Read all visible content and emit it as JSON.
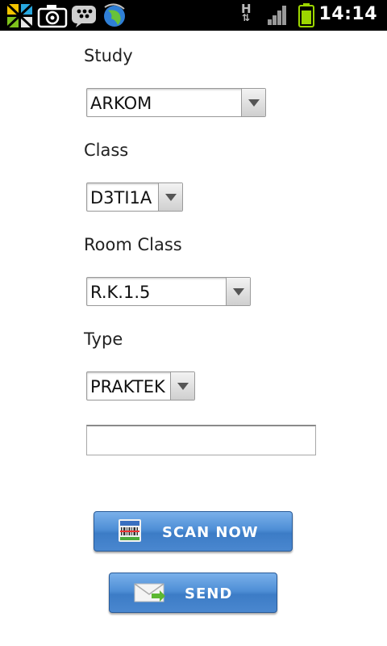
{
  "status_bar": {
    "time": "14:14",
    "icons": [
      "launcher-grid-icon",
      "camera-icon",
      "bbm-icon",
      "browser-globe-icon",
      "data-hsdpa-icon",
      "signal-icon",
      "battery-icon"
    ],
    "colors": {
      "background": "#000000",
      "text": "#ffffff",
      "battery": "#9cd600"
    }
  },
  "form": {
    "study": {
      "label": "Study",
      "value": "ARKOM"
    },
    "class": {
      "label": "Class",
      "value": "D3TI1A"
    },
    "room_class": {
      "label": "Room Class",
      "value": "R.K.1.5"
    },
    "type": {
      "label": "Type",
      "value": "PRAKTEK"
    },
    "code_input": {
      "value": ""
    }
  },
  "buttons": {
    "scan": {
      "label": "SCAN NOW",
      "icon": "barcode-icon"
    },
    "send": {
      "label": "SEND",
      "icon": "envelope-icon"
    }
  }
}
